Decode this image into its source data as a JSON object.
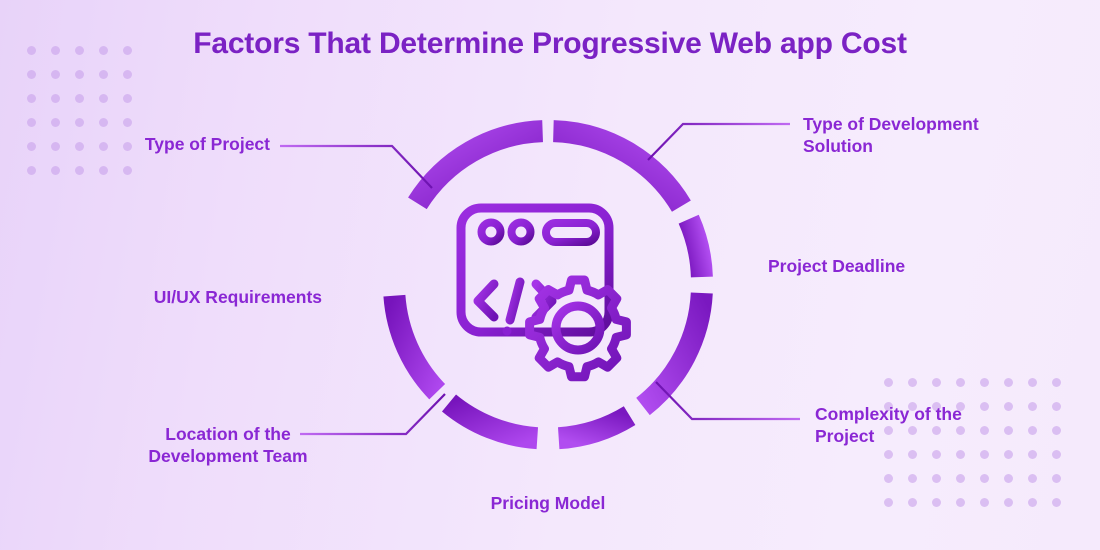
{
  "header": {
    "title": "Factors That Determine Progressive Web app Cost"
  },
  "theme": {
    "title_color": "#7B22C4",
    "label_color": "#8A27D4",
    "accent_light": "#A93BEA",
    "accent_dark": "#7A16BE",
    "background_left": "#E8D3F9",
    "background_right": "#F5EAFC",
    "dot_color": "#C9A3EC"
  },
  "center_icon": {
    "name": "browser-code-gear-icon",
    "description": "Browser window with code brackets and gear"
  },
  "factors": [
    {
      "id": "type-of-project",
      "label": "Type of Project",
      "side": "left",
      "connector": "elbow-down-right"
    },
    {
      "id": "uiux-requirements",
      "label": "UI/UX Requirements",
      "side": "left",
      "connector": "straight"
    },
    {
      "id": "location-dev-team",
      "label": "Location of the\nDevelopment Team",
      "side": "left",
      "connector": "elbow-up-right"
    },
    {
      "id": "pricing-model",
      "label": "Pricing Model",
      "side": "bottom",
      "connector": "vertical"
    },
    {
      "id": "complexity-of-project",
      "label": "Complexity of the\nProject",
      "side": "right",
      "connector": "elbow-up-left"
    },
    {
      "id": "project-deadline",
      "label": "Project Deadline",
      "side": "right",
      "connector": "straight"
    },
    {
      "id": "type-of-dev-solution",
      "label": "Type of Development\nSolution",
      "side": "right",
      "connector": "elbow-down-left"
    }
  ],
  "decoration": {
    "dots_top_left": {
      "rows": 6,
      "cols": 5
    },
    "dots_bottom_right": {
      "rows": 6,
      "cols": 8
    }
  }
}
